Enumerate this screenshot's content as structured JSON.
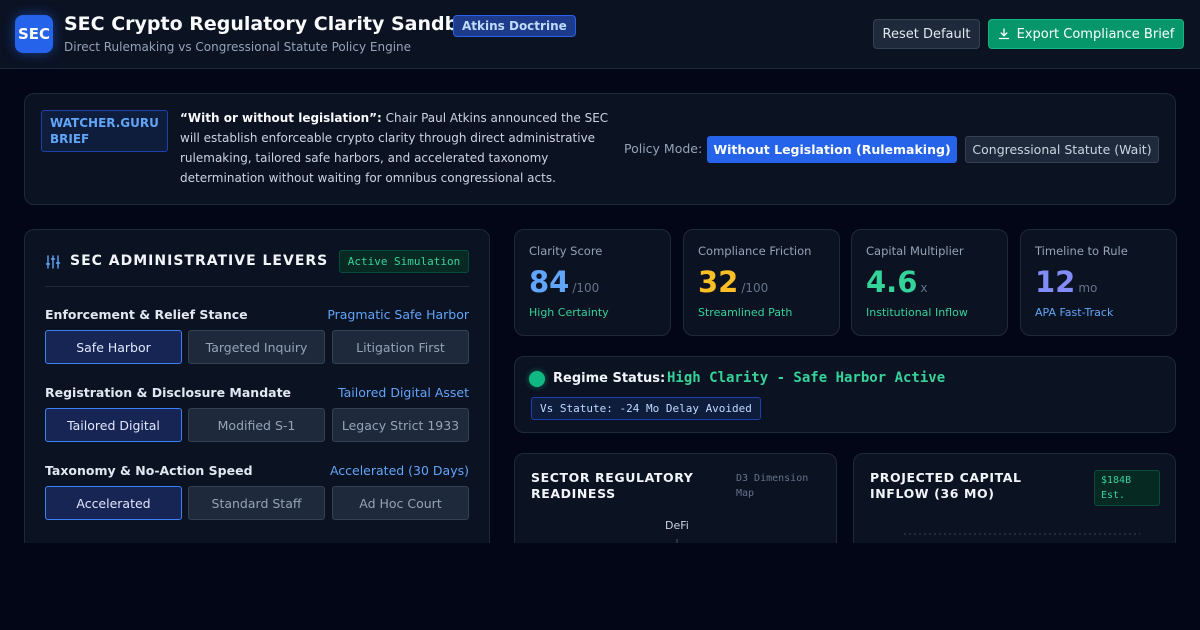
{
  "header": {
    "logo": "SEC",
    "title": "SEC Crypto Regulatory Clarity Sandbox",
    "badge": "Atkins Doctrine",
    "subtitle": "Direct Rulemaking vs Congressional Statute Policy Engine",
    "reset_label": "Reset Default",
    "export_label": "Export Compliance Brief"
  },
  "brief": {
    "source": "WATCHER.GURU BRIEF",
    "quote": "“With or without legislation”:",
    "body": " Chair Paul Atkins announced the SEC will establish enforceable crypto clarity through direct administrative rulemaking, tailored safe harbors, and accelerated taxonomy determination without waiting for omnibus congressional acts.",
    "policy_label": "Policy Mode:",
    "mode_active": "Without Legislation (Rulemaking)",
    "mode_inactive": "Congressional Statute (Wait)"
  },
  "levers": {
    "title": "SEC ADMINISTRATIVE LEVERS",
    "status": "Active Simulation",
    "groups": [
      {
        "label": "Enforcement & Relief Stance",
        "value": "Pragmatic Safe Harbor",
        "options": [
          "Safe Harbor",
          "Targeted Inquiry",
          "Litigation First"
        ],
        "selected": 0
      },
      {
        "label": "Registration & Disclosure Mandate",
        "value": "Tailored Digital Asset",
        "options": [
          "Tailored Digital",
          "Modified S-1",
          "Legacy Strict 1933"
        ],
        "selected": 0
      },
      {
        "label": "Taxonomy & No-Action Speed",
        "value": "Accelerated (30 Days)",
        "options": [
          "Accelerated",
          "Standard Staff",
          "Ad Hoc Court"
        ],
        "selected": 0
      }
    ]
  },
  "metrics": [
    {
      "label": "Clarity Score",
      "value": "84",
      "unit": "/100",
      "sub": "High Certainty",
      "color": "#60a5fa",
      "sub_color": "#34d399"
    },
    {
      "label": "Compliance Friction",
      "value": "32",
      "unit": "/100",
      "sub": "Streamlined Path",
      "color": "#fbbf24",
      "sub_color": "#34d399"
    },
    {
      "label": "Capital Multiplier",
      "value": "4.6",
      "unit": "x",
      "sub": "Institutional Inflow",
      "color": "#34d399",
      "sub_color": "#34d399"
    },
    {
      "label": "Timeline to Rule",
      "value": "12",
      "unit": "mo",
      "sub": "APA Fast-Track",
      "color": "#818cf8",
      "sub_color": "#60a5fa"
    }
  ],
  "regime": {
    "label": "Regime Status:",
    "value": "High Clarity - Safe Harbor Active",
    "statute": "Vs Statute: -24 Mo Delay Avoided"
  },
  "sector": {
    "title": "SECTOR REGULATORY READINESS",
    "meta": "D3 Dimension Map",
    "axis_label": "DeFi"
  },
  "inflow": {
    "title": "PROJECTED CAPITAL INFLOW (36 MO)",
    "badge": "$184B Est."
  }
}
